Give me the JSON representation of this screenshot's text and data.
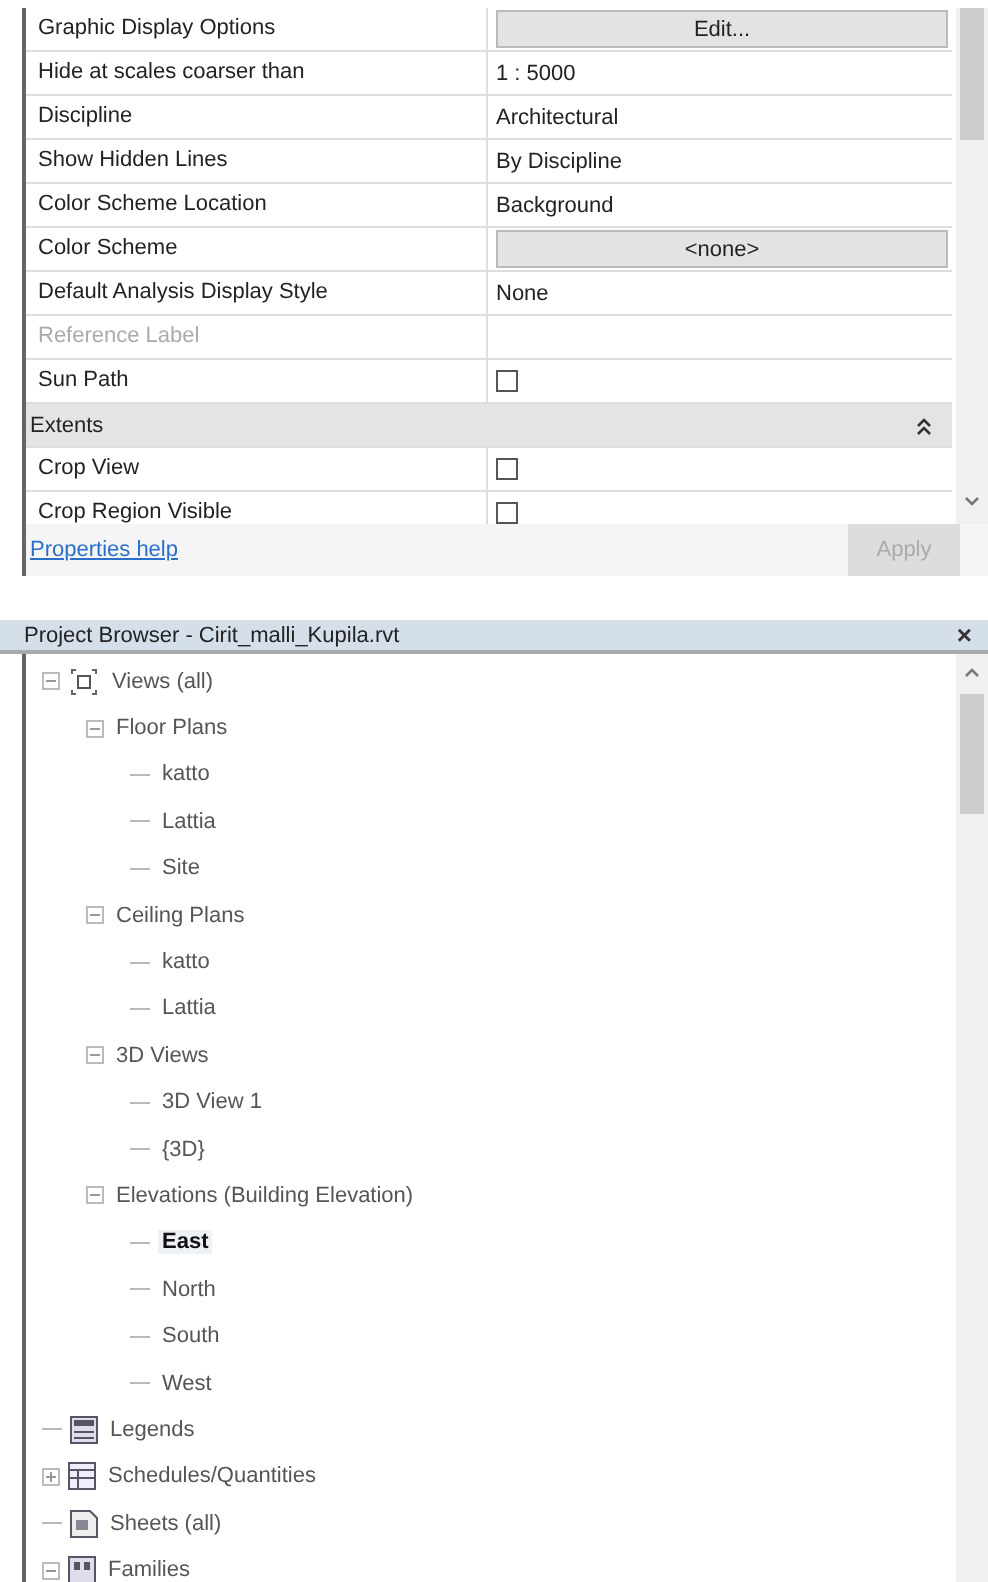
{
  "properties": {
    "rows": [
      {
        "kind": "button",
        "name": "Graphic Display Options",
        "value": "Edit..."
      },
      {
        "kind": "text",
        "name": "Hide at scales coarser than",
        "value": "1 : 5000"
      },
      {
        "kind": "text",
        "name": "Discipline",
        "value": "Architectural"
      },
      {
        "kind": "text",
        "name": "Show Hidden Lines",
        "value": "By Discipline"
      },
      {
        "kind": "text",
        "name": "Color Scheme Location",
        "value": "Background"
      },
      {
        "kind": "button",
        "name": "Color Scheme",
        "value": "<none>"
      },
      {
        "kind": "text",
        "name": "Default Analysis Display Style",
        "value": "None"
      },
      {
        "kind": "text",
        "name": "Reference Label",
        "disabled": true
      },
      {
        "kind": "checkbox",
        "name": "Sun Path",
        "checked": false
      },
      {
        "kind": "group",
        "name": "Extents",
        "expanded": true
      },
      {
        "kind": "checkbox",
        "name": "Crop View",
        "checked": false
      },
      {
        "kind": "checkbox",
        "name": "Crop Region Visible",
        "checked": false
      }
    ],
    "help_link": "Properties help",
    "apply_button": {
      "label": "Apply",
      "disabled": true
    }
  },
  "project_browser": {
    "title": "Project Browser - Cirit_malli_Kupila.rvt",
    "close": "×",
    "tree": [
      {
        "label": "Views (all)",
        "kind": "views",
        "expanded": true,
        "selected": false,
        "children": [
          {
            "label": "Floor Plans",
            "expanded": true,
            "selected": false,
            "children": [
              {
                "label": "katto",
                "selected": false
              },
              {
                "label": "Lattia",
                "selected": false
              },
              {
                "label": "Site",
                "selected": false
              }
            ]
          },
          {
            "label": "Ceiling Plans",
            "expanded": true,
            "selected": false,
            "children": [
              {
                "label": "katto",
                "selected": false
              },
              {
                "label": "Lattia",
                "selected": false
              }
            ]
          },
          {
            "label": "3D Views",
            "expanded": true,
            "selected": false,
            "children": [
              {
                "label": "3D View 1",
                "selected": false
              },
              {
                "label": "{3D}",
                "selected": false
              }
            ]
          },
          {
            "label": "Elevations (Building Elevation)",
            "expanded": true,
            "selected": false,
            "children": [
              {
                "label": "East",
                "selected": true
              },
              {
                "label": "North",
                "selected": false
              },
              {
                "label": "South",
                "selected": false
              },
              {
                "label": "West",
                "selected": false
              }
            ]
          }
        ]
      },
      {
        "label": "Legends",
        "kind": "legend",
        "selected": false
      },
      {
        "label": "Schedules/Quantities",
        "kind": "schedule",
        "expanded": false,
        "selected": false
      },
      {
        "label": "Sheets (all)",
        "kind": "sheet",
        "selected": false
      },
      {
        "label": "Families",
        "kind": "family",
        "expanded": true,
        "selected": false
      }
    ]
  }
}
